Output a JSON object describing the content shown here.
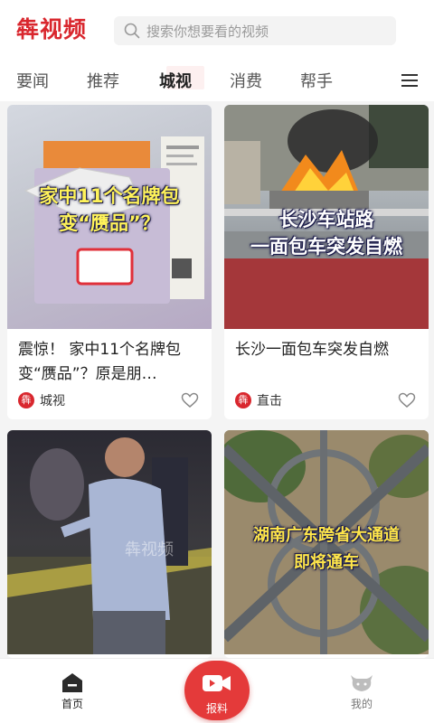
{
  "header": {
    "logo": "犇视频",
    "search_placeholder": "搜索你想要看的视频"
  },
  "tabs": [
    {
      "label": "要闻",
      "active": false
    },
    {
      "label": "推荐",
      "active": false
    },
    {
      "label": "城视",
      "active": true
    },
    {
      "label": "消费",
      "active": false
    },
    {
      "label": "帮手",
      "active": false
    }
  ],
  "cards": [
    {
      "overlay_lines": [
        "家中11个名牌包",
        "变“赝品”？"
      ],
      "title": "震惊！ 家中11个名牌包变“赝品”？原是朋…",
      "source": "城视",
      "source_badge": "犇"
    },
    {
      "overlay_lines": [
        "长沙车站路",
        "一面包车突发自燃"
      ],
      "title": "长沙一面包车突发自燃",
      "source": "直击",
      "source_badge": "犇"
    },
    {
      "overlay_lines": [
        "犇视频"
      ],
      "title": "",
      "source": "",
      "source_badge": ""
    },
    {
      "overlay_lines": [
        "湖南广东跨省大通道",
        "即将通车"
      ],
      "title": "",
      "source": "",
      "source_badge": ""
    }
  ],
  "bottom_nav": {
    "home": "首页",
    "report": "报料",
    "mine": "我的"
  },
  "colors": {
    "brand": "#d9272e",
    "report_button": "#e43a3a"
  }
}
